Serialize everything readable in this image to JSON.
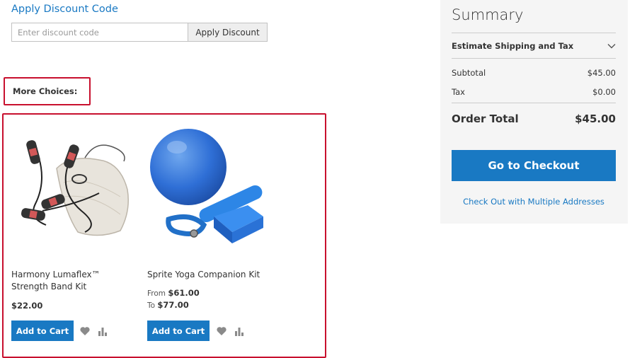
{
  "discount": {
    "title": "Apply Discount Code",
    "input_placeholder": "Enter discount code",
    "input_value": "",
    "button_label": "Apply Discount"
  },
  "more_choices": {
    "label": "More Choices:",
    "products": [
      {
        "name": "Harmony Lumaflex™ Strength Band Kit",
        "price": "$22.00",
        "add_label": "Add to Cart",
        "image": "strength-band-kit"
      },
      {
        "name": "Sprite Yoga Companion Kit",
        "price_from_label": "From",
        "price_from": "$61.00",
        "price_to_label": "To",
        "price_to": "$77.00",
        "add_label": "Add to Cart",
        "image": "yoga-companion-kit"
      }
    ]
  },
  "summary": {
    "title": "Summary",
    "shipping_label": "Estimate Shipping and Tax",
    "subtotal_label": "Subtotal",
    "subtotal_value": "$45.00",
    "tax_label": "Tax",
    "tax_value": "$0.00",
    "total_label": "Order Total",
    "total_value": "$45.00",
    "checkout_label": "Go to Checkout",
    "multi_label": "Check Out with Multiple Addresses"
  },
  "icons": {
    "wishlist": "heart-icon",
    "compare": "bar-chart-icon",
    "expand": "chevron-down-icon"
  },
  "colors": {
    "accent": "#1979c3",
    "highlight": "#c8102e",
    "summary_bg": "#f5f5f5"
  }
}
